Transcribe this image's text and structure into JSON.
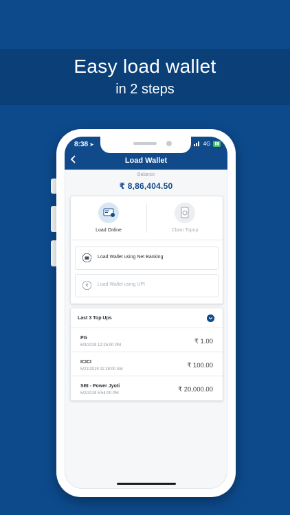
{
  "banner": {
    "line1": "Easy load wallet",
    "line2": "in 2 steps"
  },
  "status": {
    "time": "8:38",
    "network": "4G"
  },
  "nav": {
    "title": "Load Wallet",
    "back_icon": "chevron-left-icon"
  },
  "balance": {
    "label": "Balance",
    "amount": "₹ 8,86,404.50"
  },
  "modes": [
    {
      "label": "Load Online",
      "icon": "card-icon",
      "active": true
    },
    {
      "label": "Claim Topup",
      "icon": "receipt-icon",
      "active": false
    }
  ],
  "options": [
    {
      "label": "Load Wallet using Net Banking",
      "icon": "wallet-icon"
    },
    {
      "label": "Load Wallet using UPI",
      "icon": "rupee-icon"
    }
  ],
  "topups": {
    "title": "Last 3 Top Ups",
    "rows": [
      {
        "name": "PG",
        "date": "6/3/2019 12:25:00 PM",
        "amount": "₹ 1.00"
      },
      {
        "name": "ICICI",
        "date": "5/21/2019 11:28:00 AM",
        "amount": "₹ 100.00"
      },
      {
        "name": "SBI - Power Jyoti",
        "date": "5/2/2019 5:54:00 PM",
        "amount": "₹ 20,000.00"
      }
    ]
  },
  "colors": {
    "background": "#0d4a8c",
    "banner": "#0a3f78",
    "header": "#114a8b"
  }
}
